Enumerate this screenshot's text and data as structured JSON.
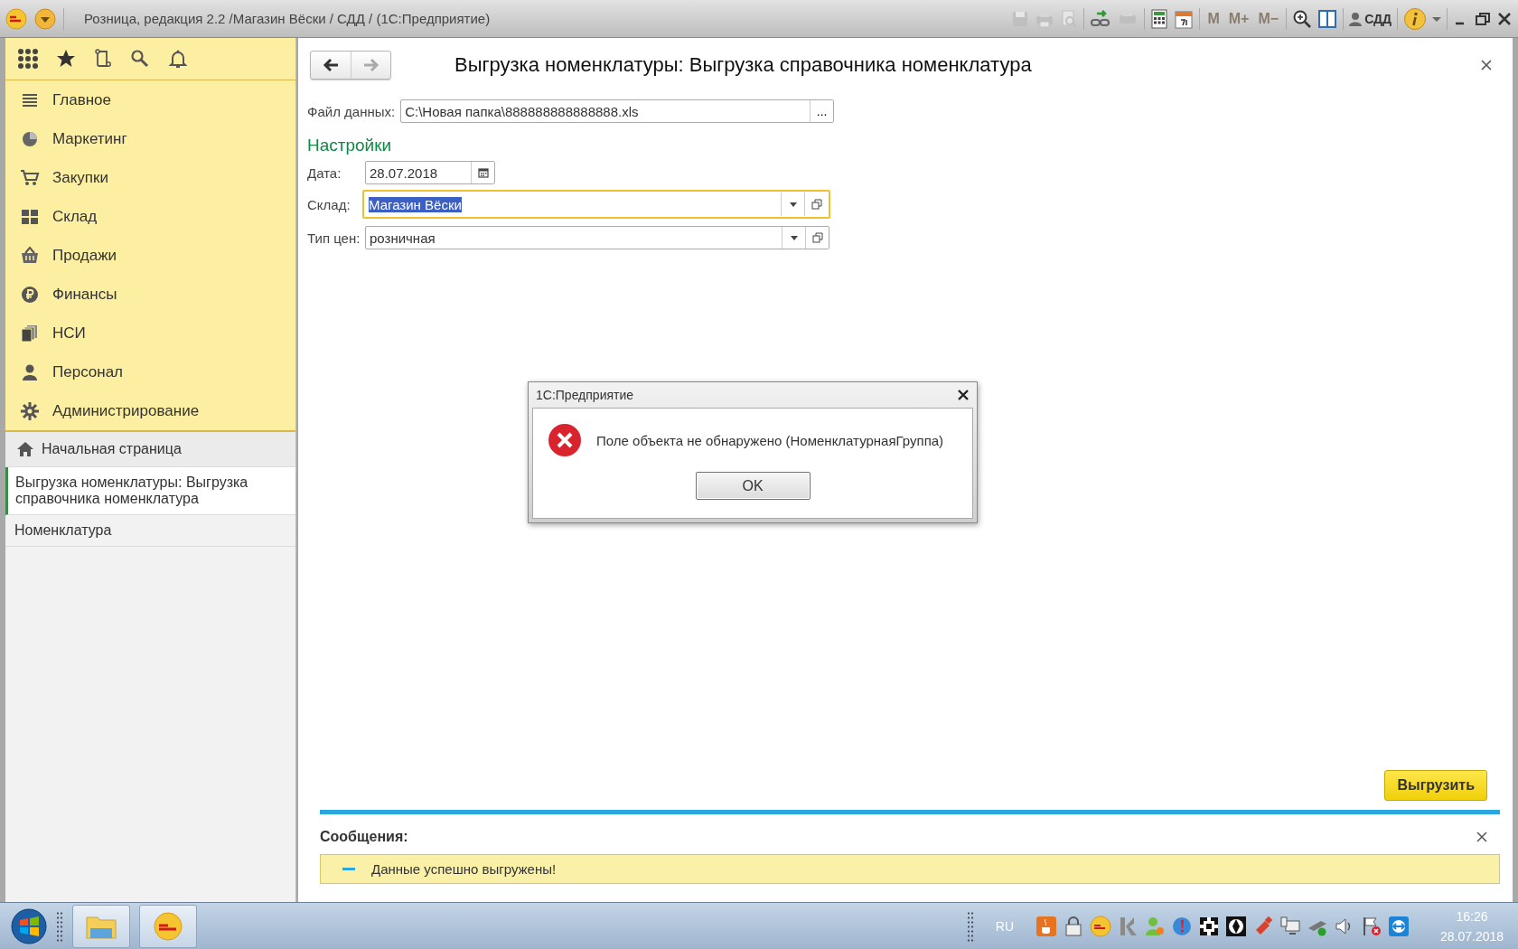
{
  "window": {
    "title": "Розница, редакция 2.2 /Магазин Вёски / СДД /  (1С:Предприятие)",
    "user": "СДД"
  },
  "toolbar": {
    "memory_buttons": [
      {
        "label": "M",
        "disabled": true
      },
      {
        "label": "M+",
        "disabled": true
      },
      {
        "label": "M−",
        "disabled": true
      }
    ]
  },
  "sidebar": {
    "sections": [
      {
        "label": "Главное"
      },
      {
        "label": "Маркетинг"
      },
      {
        "label": "Закупки"
      },
      {
        "label": "Склад"
      },
      {
        "label": "Продажи"
      },
      {
        "label": "Финансы"
      },
      {
        "label": "НСИ"
      },
      {
        "label": "Персонал"
      },
      {
        "label": "Администрирование"
      }
    ],
    "open_windows": [
      {
        "kind": "home",
        "label": "Начальная страница",
        "selected": false
      },
      {
        "kind": "form",
        "label": "Выгрузка номенклатуры: Выгрузка справочника номенклатура",
        "selected": true
      },
      {
        "kind": "form",
        "label": "Номенклатура",
        "selected": false
      }
    ]
  },
  "form": {
    "title": "Выгрузка номенклатуры: Выгрузка справочника номенклатура",
    "nav": [
      {
        "kind": "back",
        "disabled": false
      },
      {
        "kind": "forward",
        "disabled": true
      }
    ],
    "file_field": {
      "label": "Файл данных:",
      "value": "C:\\Новая папка\\888888888888888.xls",
      "button": "..."
    },
    "section": "Настройки",
    "fields": [
      {
        "kind": "date",
        "label": "Дата:",
        "value": "28.07.2018",
        "focused": false,
        "text_selected": false
      },
      {
        "kind": "select",
        "label": "Склад:",
        "value": "Магазин Вёски",
        "focused": true,
        "text_selected": true
      },
      {
        "kind": "select",
        "label": "Тип цен:",
        "value": "розничная",
        "focused": false,
        "text_selected": false
      }
    ],
    "submit": "Выгрузить"
  },
  "messages": {
    "title": "Сообщения:",
    "items": [
      {
        "text": "Данные успешно выгружены!"
      }
    ]
  },
  "dialog": {
    "title": "1С:Предприятие",
    "message": "Поле объекта не обнаружено (НоменклатурнаяГруппа)",
    "button": "OK"
  },
  "taskbar": {
    "language": "RU",
    "time": "16:26",
    "date": "28.07.2018"
  }
}
